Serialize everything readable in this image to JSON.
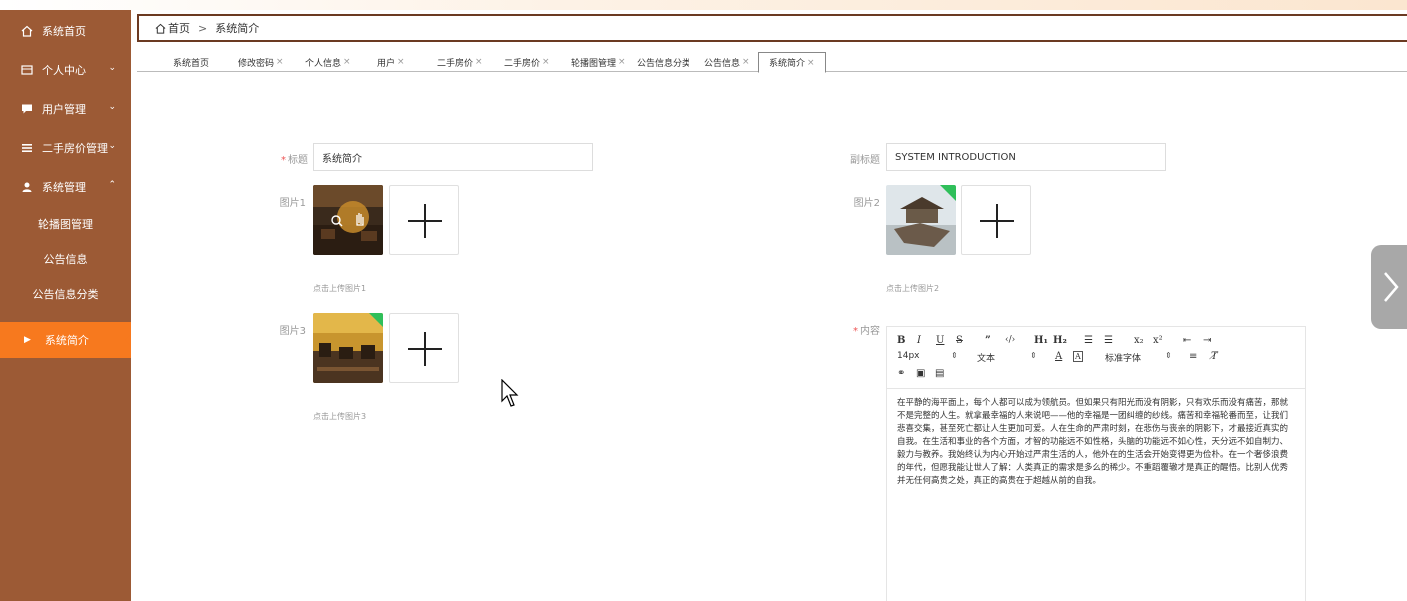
{
  "sidebar": {
    "items": [
      {
        "label": "系统首页",
        "icon": "home-icon"
      },
      {
        "label": "个人中心",
        "icon": "card-icon",
        "chevron": "⌄"
      },
      {
        "label": "用户管理",
        "icon": "chat-icon",
        "chevron": "⌄"
      },
      {
        "label": "二手房价管理",
        "icon": "list-icon",
        "chevron": "⌄"
      },
      {
        "label": "系统管理",
        "icon": "user-icon",
        "chevron": "⌃"
      }
    ],
    "subitems": [
      "轮播图管理",
      "公告信息",
      "公告信息分类"
    ],
    "active": "系统简介"
  },
  "breadcrumb": {
    "home": "首页",
    "sep": ">",
    "current": "系统简介"
  },
  "tabs": [
    {
      "label": "系统首页",
      "close": ""
    },
    {
      "label": "修改密码",
      "close": "×"
    },
    {
      "label": "个人信息",
      "close": "×"
    },
    {
      "label": "用户",
      "close": "×"
    },
    {
      "label": "二手房价",
      "close": "×"
    },
    {
      "label": "二手房价",
      "close": "×"
    },
    {
      "label": "轮播图管理",
      "close": "×"
    },
    {
      "label": "公告信息分类",
      "close": ""
    },
    {
      "label": "公告信息",
      "close": "×"
    },
    {
      "label": "系统简介",
      "close": "×"
    }
  ],
  "form": {
    "title_label": "标题",
    "title_value": "系统简介",
    "subtitle_label": "副标题",
    "subtitle_value": "SYSTEM INTRODUCTION",
    "pic1_label": "图片1",
    "pic1_hint": "点击上传图片1",
    "pic2_label": "图片2",
    "pic2_hint": "点击上传图片2",
    "pic3_label": "图片3",
    "pic3_hint": "点击上传图片3",
    "content_label": "内容",
    "required_mark": "*"
  },
  "editor": {
    "font_size": "14px",
    "block_type": "文本",
    "font_family": "标准字体",
    "content": "在平静的海平面上，每个人都可以成为领航员。但如果只有阳光而没有阴影，只有欢乐而没有痛苦，那就不是完整的人生。就拿最幸福的人来说吧——他的幸福是一团纠缠的纱线。痛苦和幸福轮番而至，让我们悲喜交集，甚至死亡都让人生更加可爱。人在生命的严肃时刻，在悲伤与丧亲的阴影下，才最接近真实的自我。在生活和事业的各个方面，才智的功能远不如性格，头脑的功能远不如心性，天分远不如自制力、毅力与教养。我始终认为内心开始过严肃生活的人，他外在的生活会开始变得更为俭朴。在一个奢侈浪费的年代，但愿我能让世人了解：人类真正的需求是多么的稀少。不重蹈覆辙才是真正的醒悟。比别人优秀并无任何高贵之处，真正的高贵在于超越从前的自我。"
  },
  "colors": {
    "sidebar": "#9c5a35",
    "active": "#f7791e"
  }
}
